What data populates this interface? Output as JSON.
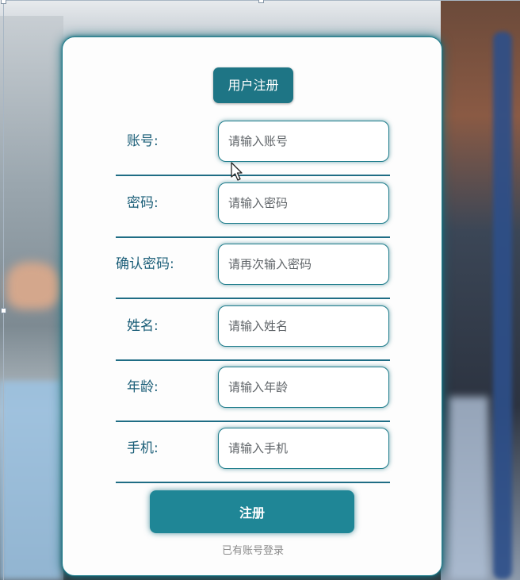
{
  "form": {
    "title": "用户注册",
    "fields": [
      {
        "label": "账号:",
        "placeholder": "请输入账号"
      },
      {
        "label": "密码:",
        "placeholder": "请输入密码"
      },
      {
        "label": "确认密码:",
        "placeholder": "请再次输入密码"
      },
      {
        "label": "姓名:",
        "placeholder": "请输入姓名"
      },
      {
        "label": "年龄:",
        "placeholder": "请输入年龄"
      },
      {
        "label": "手机:",
        "placeholder": "请输入手机"
      }
    ],
    "submit_label": "注册",
    "login_link": "已有账号登录"
  },
  "colors": {
    "accent": "#1f7d8c",
    "button": "#1f8696",
    "label": "#1b5e78"
  }
}
